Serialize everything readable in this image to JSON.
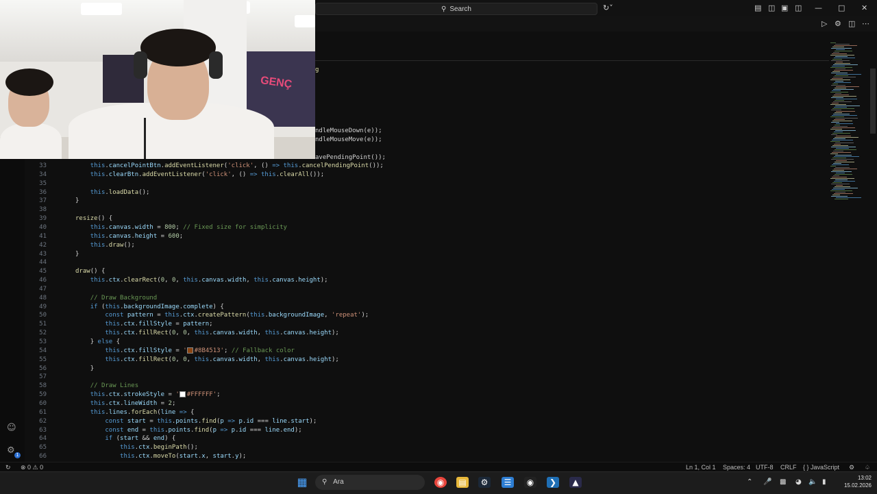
{
  "titlebar": {
    "search_label": "Search"
  },
  "editor": {
    "fragments": [
      {
        "text": "g",
        "cls": "f"
      },
      {
        "text": "ndleMouseDown(e));",
        "cls": "t"
      },
      {
        "text": "ndleMouseMove(e));",
        "cls": "t"
      },
      {
        "text": "avePendingPoint());",
        "cls": "t"
      }
    ],
    "lines": [
      {
        "n": "33",
        "html": "    <span class=\"k\">this</span><span class=\"t\">.</span><span class=\"p\">cancelPointBtn</span><span class=\"t\">.</span><span class=\"f\">addEventListener</span><span class=\"t\">(</span><span class=\"s\">'click'</span><span class=\"t\">, () </span><span class=\"k\">=&gt;</span><span class=\"t\"> </span><span class=\"k\">this</span><span class=\"t\">.</span><span class=\"f\">cancelPendingPoint</span><span class=\"t\">());</span>"
      },
      {
        "n": "34",
        "html": "    <span class=\"k\">this</span><span class=\"t\">.</span><span class=\"p\">clearBtn</span><span class=\"t\">.</span><span class=\"f\">addEventListener</span><span class=\"t\">(</span><span class=\"s\">'click'</span><span class=\"t\">, () </span><span class=\"k\">=&gt;</span><span class=\"t\"> </span><span class=\"k\">this</span><span class=\"t\">.</span><span class=\"f\">clearAll</span><span class=\"t\">());</span>"
      },
      {
        "n": "35",
        "html": ""
      },
      {
        "n": "36",
        "html": "    <span class=\"k\">this</span><span class=\"t\">.</span><span class=\"f\">loadData</span><span class=\"t\">();</span>"
      },
      {
        "n": "37",
        "html": "<span class=\"t\">}</span>"
      },
      {
        "n": "38",
        "html": ""
      },
      {
        "n": "39",
        "html": "<span class=\"f\">resize</span><span class=\"t\">() {</span>"
      },
      {
        "n": "40",
        "html": "    <span class=\"k\">this</span><span class=\"t\">.</span><span class=\"p\">canvas</span><span class=\"t\">.</span><span class=\"p\">width</span><span class=\"t\"> = </span><span class=\"n\">800</span><span class=\"t\">; </span><span class=\"c\">// Fixed size for simplicity</span>"
      },
      {
        "n": "41",
        "html": "    <span class=\"k\">this</span><span class=\"t\">.</span><span class=\"p\">canvas</span><span class=\"t\">.</span><span class=\"p\">height</span><span class=\"t\"> = </span><span class=\"n\">600</span><span class=\"t\">;</span>"
      },
      {
        "n": "42",
        "html": "    <span class=\"k\">this</span><span class=\"t\">.</span><span class=\"f\">draw</span><span class=\"t\">();</span>"
      },
      {
        "n": "43",
        "html": "<span class=\"t\">}</span>"
      },
      {
        "n": "44",
        "html": ""
      },
      {
        "n": "45",
        "html": "<span class=\"f\">draw</span><span class=\"t\">() {</span>"
      },
      {
        "n": "46",
        "html": "    <span class=\"k\">this</span><span class=\"t\">.</span><span class=\"p\">ctx</span><span class=\"t\">.</span><span class=\"f\">clearRect</span><span class=\"t\">(</span><span class=\"n\">0</span><span class=\"t\">, </span><span class=\"n\">0</span><span class=\"t\">, </span><span class=\"k\">this</span><span class=\"t\">.</span><span class=\"p\">canvas</span><span class=\"t\">.</span><span class=\"p\">width</span><span class=\"t\">, </span><span class=\"k\">this</span><span class=\"t\">.</span><span class=\"p\">canvas</span><span class=\"t\">.</span><span class=\"p\">height</span><span class=\"t\">);</span>"
      },
      {
        "n": "47",
        "html": ""
      },
      {
        "n": "48",
        "html": "    <span class=\"c\">// Draw Background</span>"
      },
      {
        "n": "49",
        "html": "    <span class=\"k\">if</span><span class=\"t\"> (</span><span class=\"k\">this</span><span class=\"t\">.</span><span class=\"p\">backgroundImage</span><span class=\"t\">.</span><span class=\"p\">complete</span><span class=\"t\">) {</span>"
      },
      {
        "n": "50",
        "html": "        <span class=\"k\">const</span><span class=\"t\"> </span><span class=\"p\">pattern</span><span class=\"t\"> = </span><span class=\"k\">this</span><span class=\"t\">.</span><span class=\"p\">ctx</span><span class=\"t\">.</span><span class=\"f\">createPattern</span><span class=\"t\">(</span><span class=\"k\">this</span><span class=\"t\">.</span><span class=\"p\">backgroundImage</span><span class=\"t\">, </span><span class=\"s\">'repeat'</span><span class=\"t\">);</span>"
      },
      {
        "n": "51",
        "html": "        <span class=\"k\">this</span><span class=\"t\">.</span><span class=\"p\">ctx</span><span class=\"t\">.</span><span class=\"p\">fillStyle</span><span class=\"t\"> = </span><span class=\"p\">pattern</span><span class=\"t\">;</span>"
      },
      {
        "n": "52",
        "html": "        <span class=\"k\">this</span><span class=\"t\">.</span><span class=\"p\">ctx</span><span class=\"t\">.</span><span class=\"f\">fillRect</span><span class=\"t\">(</span><span class=\"n\">0</span><span class=\"t\">, </span><span class=\"n\">0</span><span class=\"t\">, </span><span class=\"k\">this</span><span class=\"t\">.</span><span class=\"p\">canvas</span><span class=\"t\">.</span><span class=\"p\">width</span><span class=\"t\">, </span><span class=\"k\">this</span><span class=\"t\">.</span><span class=\"p\">canvas</span><span class=\"t\">.</span><span class=\"p\">height</span><span class=\"t\">);</span>"
      },
      {
        "n": "53",
        "html": "    <span class=\"t\">} </span><span class=\"k\">else</span><span class=\"t\"> {</span>"
      },
      {
        "n": "54",
        "html": "        <span class=\"k\">this</span><span class=\"t\">.</span><span class=\"p\">ctx</span><span class=\"t\">.</span><span class=\"p\">fillStyle</span><span class=\"t\"> = </span><span class=\"s\">'<span class=\"swatch\" style=\"background:#8B4513\"></span>#8B4513'</span><span class=\"t\">; </span><span class=\"c\">// Fallback color</span>"
      },
      {
        "n": "55",
        "html": "        <span class=\"k\">this</span><span class=\"t\">.</span><span class=\"p\">ctx</span><span class=\"t\">.</span><span class=\"f\">fillRect</span><span class=\"t\">(</span><span class=\"n\">0</span><span class=\"t\">, </span><span class=\"n\">0</span><span class=\"t\">, </span><span class=\"k\">this</span><span class=\"t\">.</span><span class=\"p\">canvas</span><span class=\"t\">.</span><span class=\"p\">width</span><span class=\"t\">, </span><span class=\"k\">this</span><span class=\"t\">.</span><span class=\"p\">canvas</span><span class=\"t\">.</span><span class=\"p\">height</span><span class=\"t\">);</span>"
      },
      {
        "n": "56",
        "html": "    <span class=\"t\">}</span>"
      },
      {
        "n": "57",
        "html": ""
      },
      {
        "n": "58",
        "html": "    <span class=\"c\">// Draw Lines</span>"
      },
      {
        "n": "59",
        "html": "    <span class=\"k\">this</span><span class=\"t\">.</span><span class=\"p\">ctx</span><span class=\"t\">.</span><span class=\"p\">strokeStyle</span><span class=\"t\"> = </span><span class=\"s\">'<span class=\"swatch\" style=\"background:#FFFFFF\"></span>#FFFFFF'</span><span class=\"t\">;</span>"
      },
      {
        "n": "60",
        "html": "    <span class=\"k\">this</span><span class=\"t\">.</span><span class=\"p\">ctx</span><span class=\"t\">.</span><span class=\"p\">lineWidth</span><span class=\"t\"> = </span><span class=\"n\">2</span><span class=\"t\">;</span>"
      },
      {
        "n": "61",
        "html": "    <span class=\"k\">this</span><span class=\"t\">.</span><span class=\"p\">lines</span><span class=\"t\">.</span><span class=\"f\">forEach</span><span class=\"t\">(</span><span class=\"p\">line</span><span class=\"t\"> </span><span class=\"k\">=&gt;</span><span class=\"t\"> {</span>"
      },
      {
        "n": "62",
        "html": "        <span class=\"k\">const</span><span class=\"t\"> </span><span class=\"p\">start</span><span class=\"t\"> = </span><span class=\"k\">this</span><span class=\"t\">.</span><span class=\"p\">points</span><span class=\"t\">.</span><span class=\"f\">find</span><span class=\"t\">(</span><span class=\"p\">p</span><span class=\"t\"> </span><span class=\"k\">=&gt;</span><span class=\"t\"> </span><span class=\"p\">p</span><span class=\"t\">.</span><span class=\"p\">id</span><span class=\"t\"> === </span><span class=\"p\">line</span><span class=\"t\">.</span><span class=\"p\">start</span><span class=\"t\">);</span>"
      },
      {
        "n": "63",
        "html": "        <span class=\"k\">const</span><span class=\"t\"> </span><span class=\"p\">end</span><span class=\"t\"> = </span><span class=\"k\">this</span><span class=\"t\">.</span><span class=\"p\">points</span><span class=\"t\">.</span><span class=\"f\">find</span><span class=\"t\">(</span><span class=\"p\">p</span><span class=\"t\"> </span><span class=\"k\">=&gt;</span><span class=\"t\"> </span><span class=\"p\">p</span><span class=\"t\">.</span><span class=\"p\">id</span><span class=\"t\"> === </span><span class=\"p\">line</span><span class=\"t\">.</span><span class=\"p\">end</span><span class=\"t\">);</span>"
      },
      {
        "n": "64",
        "html": "        <span class=\"k\">if</span><span class=\"t\"> (</span><span class=\"p\">start</span><span class=\"t\"> &amp;&amp; </span><span class=\"p\">end</span><span class=\"t\">) {</span>"
      },
      {
        "n": "65",
        "html": "            <span class=\"k\">this</span><span class=\"t\">.</span><span class=\"p\">ctx</span><span class=\"t\">.</span><span class=\"f\">beginPath</span><span class=\"t\">();</span>"
      },
      {
        "n": "66",
        "html": "            <span class=\"k\">this</span><span class=\"t\">.</span><span class=\"p\">ctx</span><span class=\"t\">.</span><span class=\"f\">moveTo</span><span class=\"t\">(</span><span class=\"p\">start</span><span class=\"t\">.</span><span class=\"p\">x</span><span class=\"t\">, </span><span class=\"p\">start</span><span class=\"t\">.</span><span class=\"p\">y</span><span class=\"t\">);</span>"
      }
    ]
  },
  "statusbar": {
    "problems": "⊗ 0 ⚠ 0",
    "position": "Ln 1, Col 1",
    "spaces": "Spaces: 4",
    "encoding": "UTF-8",
    "eol": "CRLF",
    "language": "{ } JavaScript"
  },
  "taskbar": {
    "search_label": "Ara",
    "time": "13:02",
    "date": "15.02.2026"
  },
  "webcam": {
    "sign_text": "GENÇ"
  },
  "colors": {
    "editor_bg": "#0f0f0f",
    "accent": "#2a6ed0"
  }
}
